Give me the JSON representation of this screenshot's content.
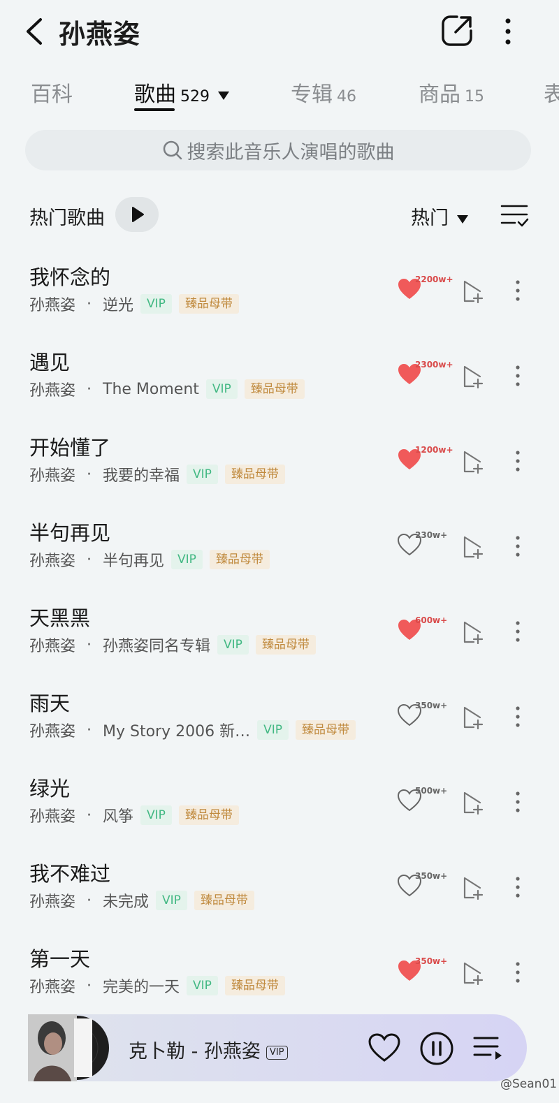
{
  "header": {
    "title": "孙燕姿"
  },
  "tabs": [
    {
      "label": "百科",
      "count": ""
    },
    {
      "label": "歌曲",
      "count": "529"
    },
    {
      "label": "专辑",
      "count": "46"
    },
    {
      "label": "商品",
      "count": "15"
    },
    {
      "label": "表",
      "count": ""
    }
  ],
  "search": {
    "placeholder": "搜索此音乐人演唱的歌曲"
  },
  "section": {
    "title": "热门歌曲",
    "sort": "热门"
  },
  "songs": [
    {
      "title": "我怀念的",
      "artist": "孙燕姿",
      "album": "逆光",
      "vip": "VIP",
      "quality": "臻品母带",
      "likes": "2200w+",
      "liked": true
    },
    {
      "title": "遇见",
      "artist": "孙燕姿",
      "album": "The Moment",
      "vip": "VIP",
      "quality": "臻品母带",
      "likes": "2300w+",
      "liked": true
    },
    {
      "title": "开始懂了",
      "artist": "孙燕姿",
      "album": "我要的幸福",
      "vip": "VIP",
      "quality": "臻品母带",
      "likes": "1200w+",
      "liked": true
    },
    {
      "title": "半句再见",
      "artist": "孙燕姿",
      "album": "半句再见",
      "vip": "VIP",
      "quality": "臻品母带",
      "likes": "230w+",
      "liked": false
    },
    {
      "title": "天黑黑",
      "artist": "孙燕姿",
      "album": "孙燕姿同名专辑",
      "vip": "VIP",
      "quality": "臻品母带",
      "likes": "600w+",
      "liked": true
    },
    {
      "title": "雨天",
      "artist": "孙燕姿",
      "album": "My Story 2006 新…",
      "vip": "VIP",
      "quality": "臻品母带",
      "likes": "350w+",
      "liked": false
    },
    {
      "title": "绿光",
      "artist": "孙燕姿",
      "album": "风筝",
      "vip": "VIP",
      "quality": "臻品母带",
      "likes": "500w+",
      "liked": false
    },
    {
      "title": "我不难过",
      "artist": "孙燕姿",
      "album": "未完成",
      "vip": "VIP",
      "quality": "臻品母带",
      "likes": "350w+",
      "liked": false
    },
    {
      "title": "第一天",
      "artist": "孙燕姿",
      "album": "完美的一天",
      "vip": "VIP",
      "quality": "臻品母带",
      "likes": "350w+",
      "liked": true
    }
  ],
  "player": {
    "now_playing": "克卜勒 - 孙燕姿",
    "vip": "VIP"
  },
  "watermark": "@Sean01",
  "colors": {
    "liked_heart": "#f05a5a",
    "vip_text": "#42b883",
    "master_text": "#c08a3e"
  }
}
